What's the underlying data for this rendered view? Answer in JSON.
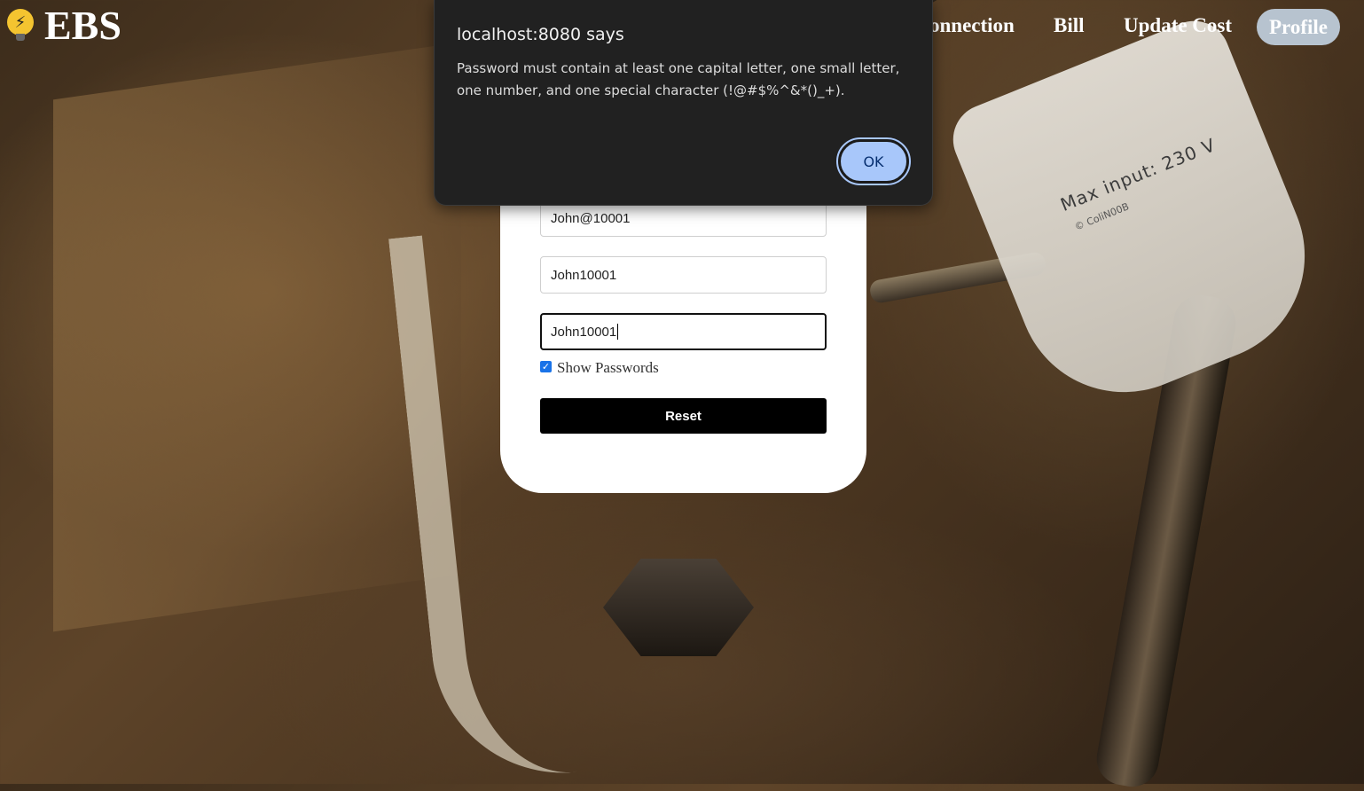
{
  "nav": {
    "logo_icon": "lightning-bulb-icon",
    "logo_text": "EBS",
    "items": [
      {
        "label": "onnection"
      },
      {
        "label": "Bill"
      },
      {
        "label": "Update Cost"
      }
    ],
    "profile_label": "Profile"
  },
  "background_text": {
    "cup_text": "Max input: 230 V",
    "cup_sub": "© ColiN00B"
  },
  "form": {
    "field1_value": "John@10001",
    "field2_value": "John10001",
    "field3_value": "John10001",
    "show_passwords_label": "Show Passwords",
    "show_passwords_checked": true,
    "reset_label": "Reset"
  },
  "dialog": {
    "title": "localhost:8080 says",
    "message": "Password must contain at least one capital letter, one small letter, one number, and one special character (!@#$%^&*()_+).",
    "ok_label": "OK"
  },
  "colors": {
    "dialog_bg": "#212121",
    "ok_button": "#a8c7fa",
    "profile_pill": "#b7c3cf",
    "reset_button": "#000000"
  }
}
